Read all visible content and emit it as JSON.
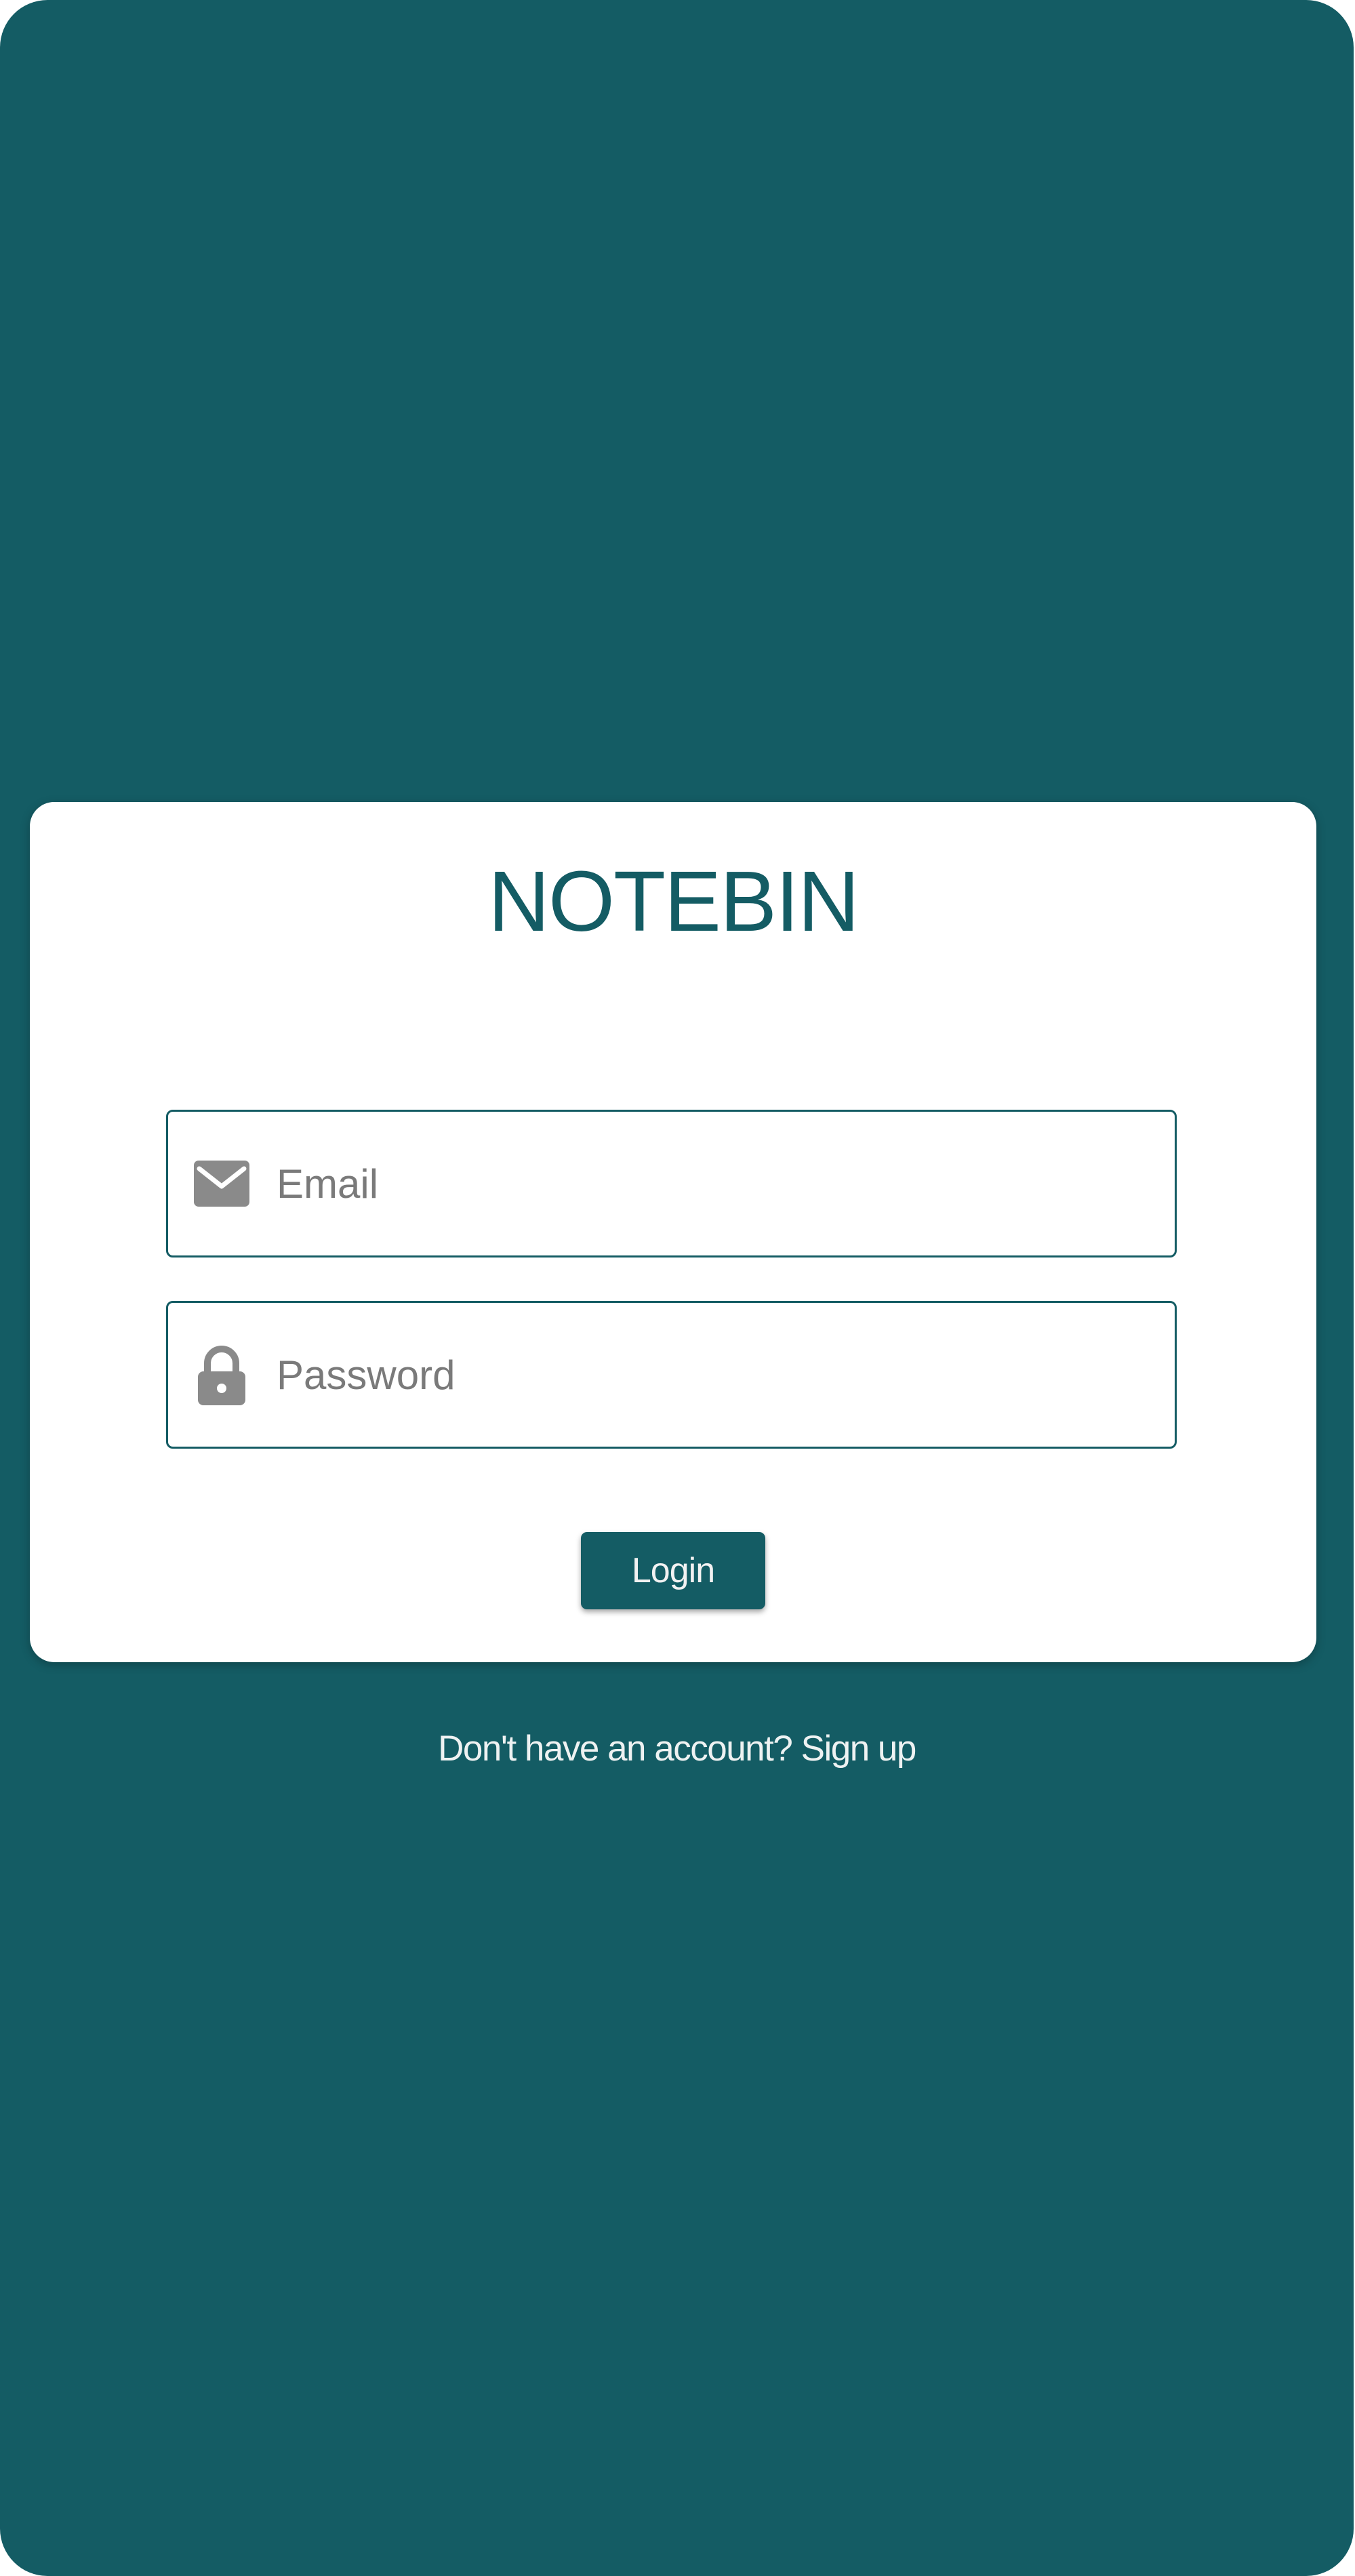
{
  "app": {
    "brand_title": "NOTEBIN"
  },
  "login_form": {
    "email": {
      "placeholder": "Email",
      "value": "",
      "icon": "mail-icon"
    },
    "password": {
      "placeholder": "Password",
      "value": "",
      "icon": "lock-icon"
    },
    "submit_label": "Login"
  },
  "signup_prompt": {
    "text": "Don't have an account?",
    "link_label": "Sign up"
  },
  "colors": {
    "primary": "#145c64",
    "card_background": "#ffffff",
    "icon_gray": "#8a8a8a",
    "placeholder_gray": "#7a7a7a",
    "light_text": "#eef2f2"
  }
}
